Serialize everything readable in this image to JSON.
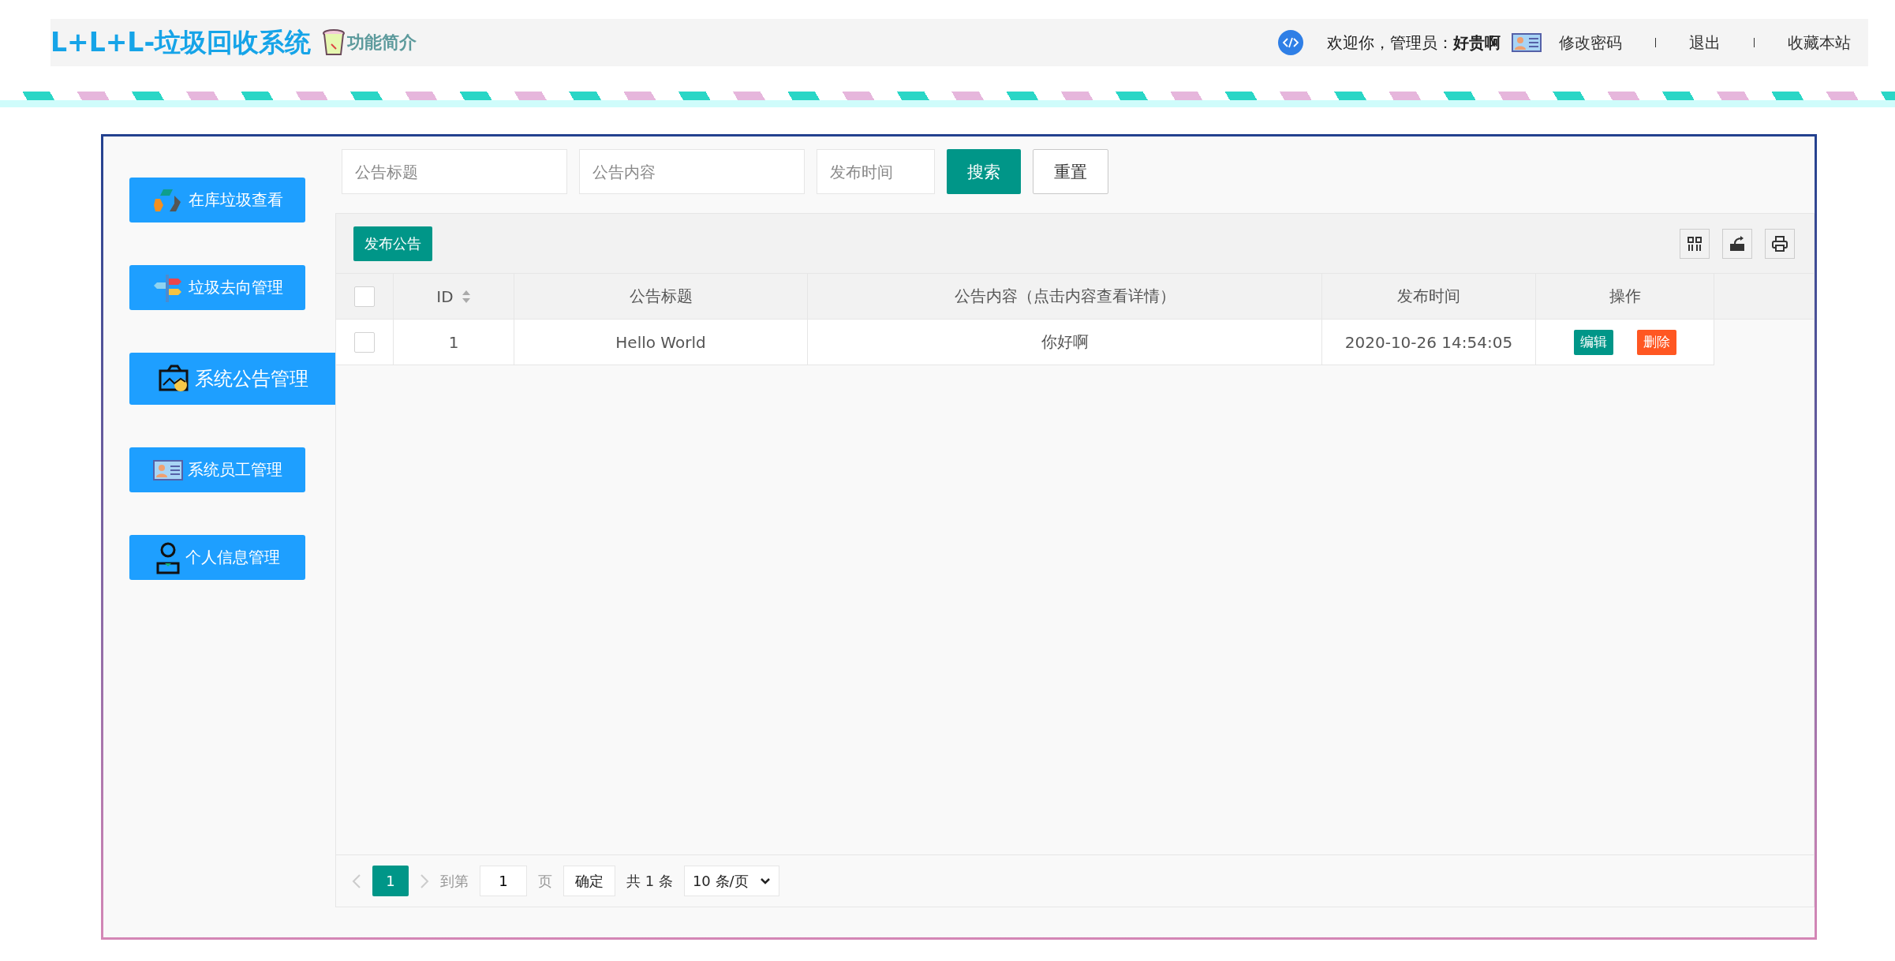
{
  "header": {
    "title": "L+L+L-垃圾回收系统",
    "intro_link": "功能简介",
    "welcome": "欢迎你，管理员：",
    "user_name": "好贵啊",
    "links": [
      "修改密码",
      "退出",
      "收藏本站"
    ]
  },
  "sidebar": {
    "items": [
      {
        "label": "在库垃圾查看",
        "kind": "recycle",
        "selected": false
      },
      {
        "label": "垃圾去向管理",
        "kind": "signpost",
        "selected": false
      },
      {
        "label": "系统公告管理",
        "kind": "picture",
        "selected": true
      },
      {
        "label": "系统员工管理",
        "kind": "idcard",
        "selected": false
      },
      {
        "label": "个人信息管理",
        "kind": "person",
        "selected": false
      }
    ]
  },
  "search": {
    "fields": [
      {
        "placeholder": "公告标题"
      },
      {
        "placeholder": "公告内容"
      },
      {
        "placeholder": "发布时间"
      }
    ],
    "buttons": [
      {
        "label": "搜索",
        "kind": "primary"
      },
      {
        "label": "重置",
        "kind": "plain"
      }
    ]
  },
  "toolbar": {
    "add_button": "发布公告"
  },
  "table": {
    "header_checked": false,
    "columns": [
      {
        "label": "ID",
        "sortable": true
      },
      {
        "label": "公告标题",
        "sortable": false
      },
      {
        "label": "公告内容（点击内容查看详情）",
        "sortable": false
      },
      {
        "label": "发布时间",
        "sortable": false
      },
      {
        "label": "操作",
        "sortable": false
      }
    ],
    "rows": [
      {
        "checked": false,
        "id": "1",
        "title": "Hello World",
        "content": "你好啊",
        "time": "2020-10-26 14:54:05",
        "actions": [
          {
            "label": "编辑",
            "kind": "edit"
          },
          {
            "label": "删除",
            "kind": "delete"
          }
        ]
      }
    ]
  },
  "pagination": {
    "pages": [
      {
        "label": "1",
        "selected": true
      }
    ],
    "goto_label": "到第",
    "goto_value": "1",
    "page_unit": "页",
    "confirm": "确定",
    "total": "共 1 条",
    "page_size": "10 条/页"
  }
}
